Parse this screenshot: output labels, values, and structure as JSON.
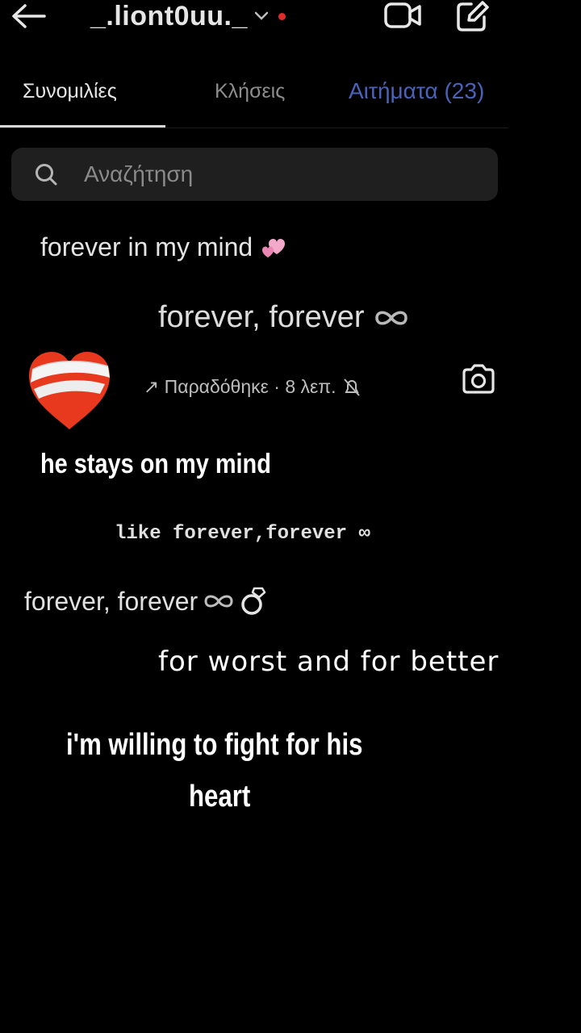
{
  "header": {
    "username": "_.liont0uu._",
    "back_icon": "arrow-left-icon",
    "video_icon": "video-call-icon",
    "edit_icon": "new-message-icon",
    "status_color": "#e02b2b"
  },
  "tabs": [
    {
      "label": "Συνομιλίες",
      "active": true
    },
    {
      "label": "Κλήσεις",
      "active": false
    },
    {
      "label": "Αιτήματα (23)",
      "active": false
    }
  ],
  "search": {
    "placeholder": "Αναζήτηση"
  },
  "lines": {
    "line1": "forever in my mind",
    "line2": "forever, forever",
    "delivered": "↗ Παραδόθηκε · 8 λεπ.",
    "line3": "he stays on my mind",
    "line4": "like forever,forever ∞",
    "line5": "forever, forever",
    "line6": "for worst and for better",
    "line7": "i'm willing to fight for his",
    "line8": "heart"
  },
  "colors": {
    "background": "#000000",
    "requests_tab": "#4a62b8",
    "search_bg": "#1f1f1f"
  }
}
